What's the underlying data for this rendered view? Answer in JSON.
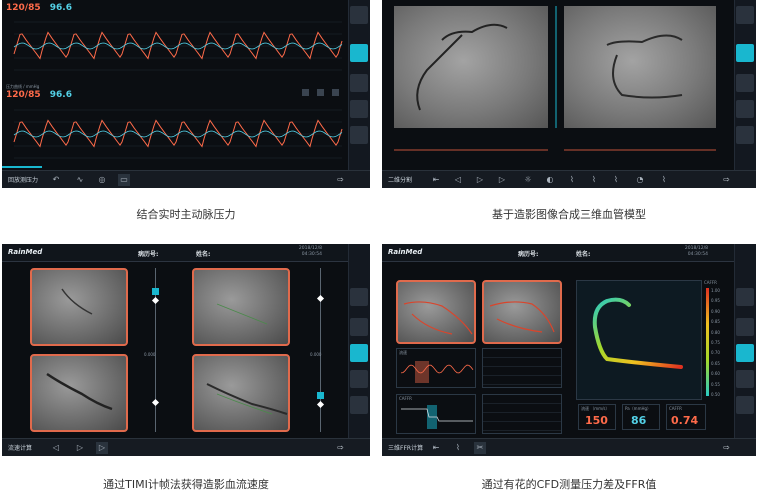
{
  "colors": {
    "accent": "#19b7cf",
    "systolic": "#ff6b4a",
    "diastolic": "#53d0e6",
    "frame": "#e06a4c"
  },
  "captions": {
    "p1": "结合实时主动脉压力",
    "p2": "基于造影图像合成三维血管模型",
    "p3": "通过TIMI计帧法获得造影血流速度",
    "p4": "通过有花的CFD测量压力差及FFR值"
  },
  "panel1": {
    "pressure_top": {
      "sys": "120/85",
      "val": "96.6"
    },
    "pressure_bottom": {
      "sys": "120/85",
      "val": "96.6"
    },
    "mid_label": "压力曲线 / mmHg",
    "footer_label": "回放测压力"
  },
  "panel2": {
    "footer_label": "二维分割"
  },
  "panel3": {
    "logo": "RainMed",
    "record_label": "病历号:",
    "name_label": "姓名:",
    "date": "2018/12/8",
    "time": "04:30:54",
    "slider_value": "0.000",
    "footer_label": "流速计算"
  },
  "panel4": {
    "logo": "RainMed",
    "record_label": "病历号:",
    "name_label": "姓名:",
    "date": "2018/12/8",
    "time": "04:30:54",
    "chart1_label": "流速",
    "chart2_label": "CAFFR",
    "metrics": [
      {
        "label": "流速 （mm/s）",
        "value": "150"
      },
      {
        "label": "Pa（mmHg）",
        "value": "86"
      },
      {
        "label": "CAFFR",
        "value": "0.74"
      }
    ],
    "scale_title": "CAFFR",
    "scale_ticks": [
      "1.00",
      "0.95",
      "0.90",
      "0.85",
      "0.80",
      "0.75",
      "0.70",
      "0.65",
      "0.60",
      "0.55",
      "0.50"
    ],
    "footer_label": "三维FFR计算"
  }
}
